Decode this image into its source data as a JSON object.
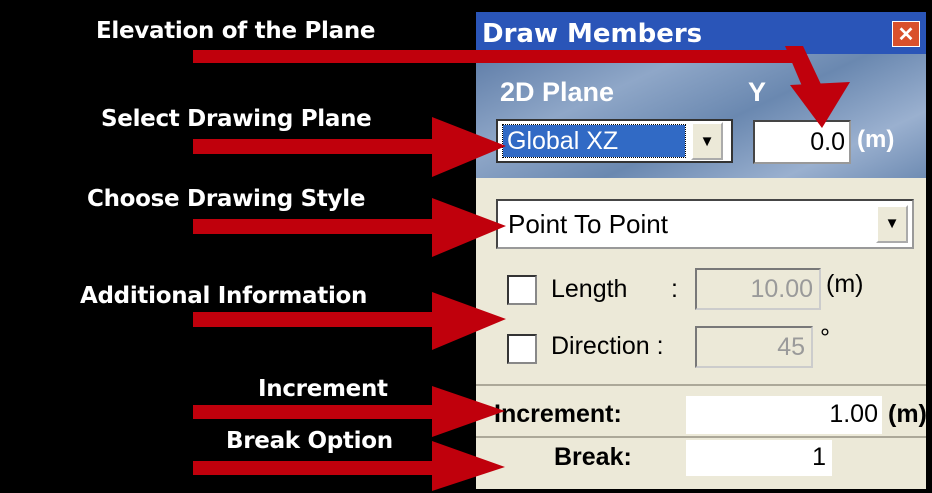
{
  "annotations": {
    "elevation": "Elevation of the Plane",
    "select_plane": "Select Drawing Plane",
    "choose_style": "Choose Drawing Style",
    "additional_info": "Additional Information",
    "increment": "Increment",
    "break_option": "Break Option"
  },
  "dialog": {
    "title": "Draw Members",
    "close_glyph": "✕",
    "plane_label": "2D Plane",
    "axis_label": "Y",
    "plane_value": "Global XZ",
    "elevation_value": "0.0",
    "elevation_unit": "(m)",
    "style_value": "Point To Point",
    "length_label": "Length",
    "length_colon": ":",
    "length_value": "10.00",
    "length_unit": "(m)",
    "direction_label": "Direction :",
    "direction_value": "45",
    "direction_unit": "°",
    "increment_label": "Increment:",
    "increment_value": "1.00",
    "increment_unit": "(m)",
    "break_label": "Break:",
    "break_value": "1"
  },
  "colors": {
    "arrow": "#c0000c",
    "titlebar": "#2a55b8",
    "panel": "#ece9d8",
    "selection": "#316ac5"
  }
}
